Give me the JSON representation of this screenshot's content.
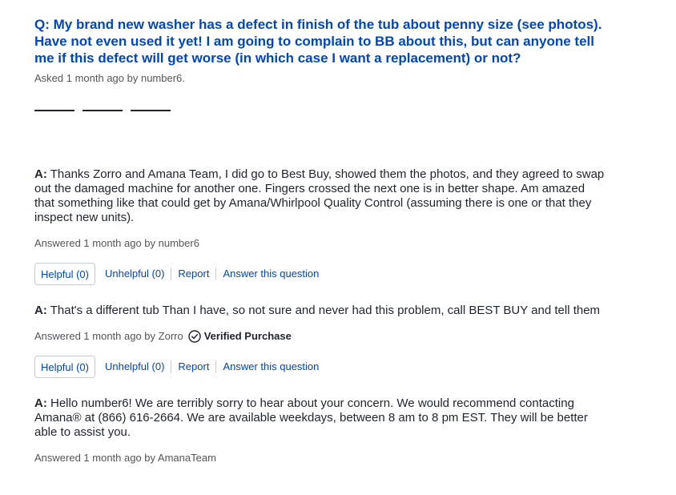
{
  "question": {
    "prefix": "Q:",
    "text": "My brand new washer has a defect in finish of the tub about penny size (see photos). Have not even used it yet! I am going to complain to BB about this, but can anyone tell me if this defect will get worse (in which case I want a replacement) or not?",
    "asked": "Asked 1 month ago by number6."
  },
  "answers": [
    {
      "prefix": "A:",
      "text": "Thanks Zorro and Amana Team, I did go to Best Buy, showed them the photos, and they agreed to swap out the damaged machine for another one. Fingers crossed the next one is in better shape. Am amazed that something like that could get by Amana/Whirlpool Quality Control (assuming there is one or that they inspect new units).",
      "meta": "Answered 1 month ago by number6",
      "helpful": "Helpful (0)",
      "unhelpful": "Unhelpful (0)",
      "report": "Report",
      "answer_link": "Answer this question"
    },
    {
      "prefix": "A:",
      "text": "That's a different tub Than I have, so not sure and never had this problem, call BEST BUY and tell them",
      "meta": "Answered 1 month ago by Zorro",
      "verified": "Verified Purchase",
      "helpful": "Helpful (0)",
      "unhelpful": "Unhelpful (0)",
      "report": "Report",
      "answer_link": "Answer this question"
    },
    {
      "prefix": "A:",
      "text": "Hello number6! We are terribly sorry to hear about your concern. We would recommend contacting Amana® at (866) 616-2664. We are available weekdays, between 8 am to 8 pm EST. They will be better able to assist you.",
      "meta": "Answered 1 month ago by AmanaTeam"
    }
  ],
  "colors": {
    "link": "#0046be",
    "text": "#1d252c",
    "meta": "#55555a",
    "border": "#c5cbd5"
  },
  "icons": {
    "verified": "check-circle-icon"
  }
}
